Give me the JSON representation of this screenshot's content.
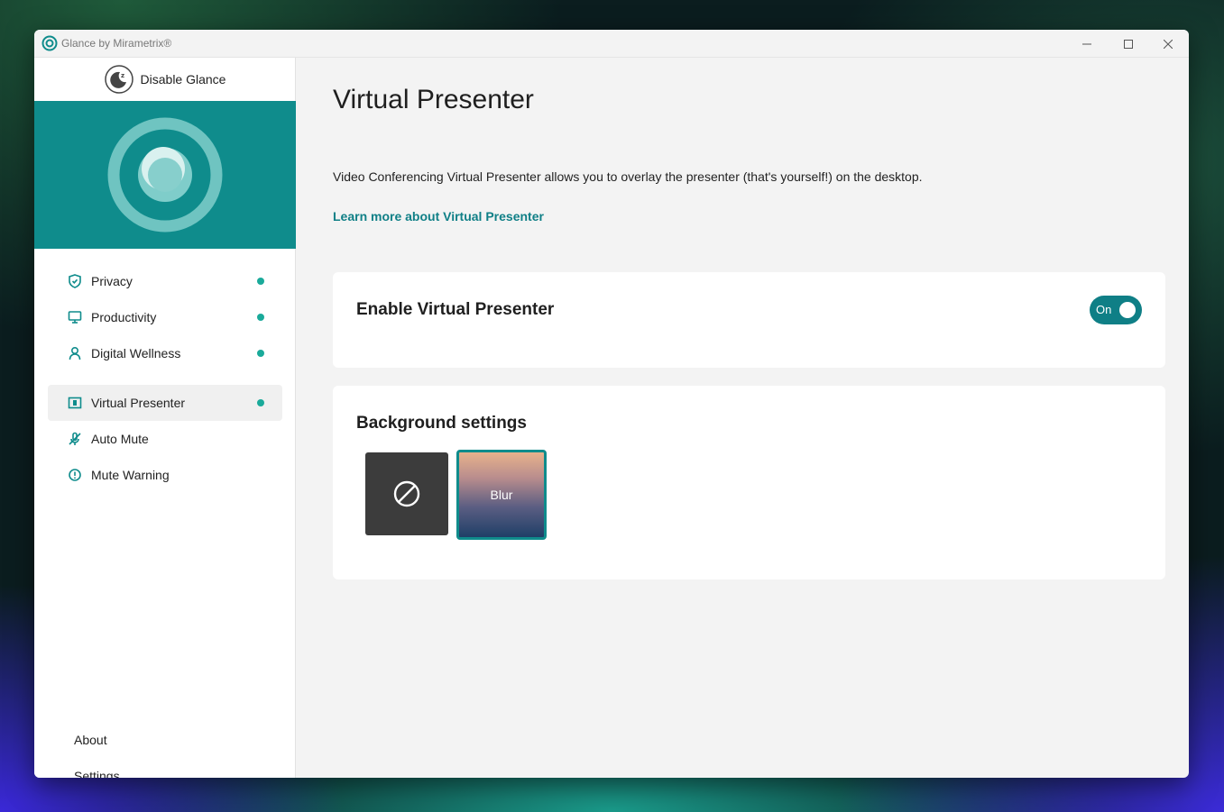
{
  "window": {
    "title": "Glance by Mirametrix®"
  },
  "sidebar": {
    "disable_label": "Disable Glance",
    "items": [
      {
        "label": "Privacy",
        "icon": "shield-icon"
      },
      {
        "label": "Productivity",
        "icon": "monitor-icon"
      },
      {
        "label": "Digital Wellness",
        "icon": "person-icon"
      },
      {
        "label": "Virtual Presenter",
        "icon": "presenter-icon",
        "active": true
      },
      {
        "label": "Auto Mute",
        "icon": "mic-mute-icon"
      },
      {
        "label": "Mute Warning",
        "icon": "info-icon"
      }
    ],
    "about_label": "About",
    "settings_label": "Settings"
  },
  "main": {
    "title": "Virtual Presenter",
    "description": "Video Conferencing Virtual Presenter allows you to overlay the presenter (that's yourself!) on the desktop.",
    "learn_more": "Learn more about Virtual Presenter",
    "enable_card": {
      "title": "Enable Virtual Presenter",
      "toggle_label": "On",
      "toggle_state": true
    },
    "background_card": {
      "title": "Background settings",
      "options": [
        {
          "label": "",
          "icon": "no-background-icon"
        },
        {
          "label": "Blur",
          "selected": true
        }
      ]
    }
  },
  "colors": {
    "accent": "#0f8c8c",
    "toggle": "#0f7f86",
    "status_dot": "#1aaa9a"
  }
}
